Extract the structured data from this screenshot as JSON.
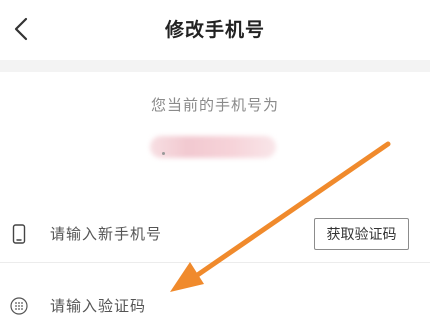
{
  "nav": {
    "back_icon": "chevron-left-icon",
    "title": "修改手机号"
  },
  "current": {
    "label": "您当前的手机号为"
  },
  "form": {
    "phone_placeholder": "请输入新手机号",
    "phone_icon": "phone-icon",
    "get_code_label": "获取验证码",
    "code_placeholder": "请输入验证码",
    "code_icon": "grid-icon"
  },
  "annotation": {
    "arrow_color": "#f08a2c"
  }
}
